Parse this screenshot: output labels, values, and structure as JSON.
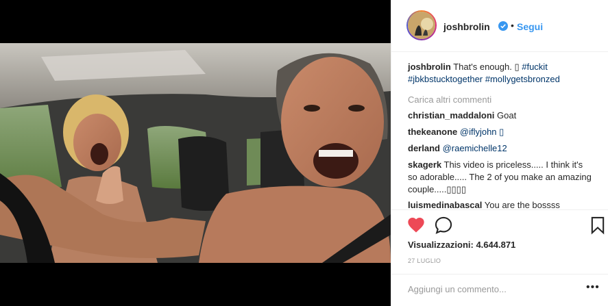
{
  "header": {
    "username": "joshbrolin",
    "dot": "•",
    "follow_label": "Segui"
  },
  "caption": {
    "username": "joshbrolin",
    "text": "That's enough. ▯",
    "tags": [
      "#fuckit",
      "#jbkbstucktogether",
      "#mollygetsbronzed"
    ]
  },
  "load_more": "Carica altri commenti",
  "comments": [
    {
      "user": "christian_maddaloni",
      "text": "Goat"
    },
    {
      "user": "thekeanone",
      "text": "@iflyjohn ▯"
    },
    {
      "user": "derland",
      "text": "@raemichelle12"
    },
    {
      "user": "skagerk",
      "text": "This video is priceless..... I think it's so adorable..... The 2 of you make an amazing couple.....▯▯▯▯"
    },
    {
      "user": "luismedinabascal",
      "text": "You are the bossss"
    }
  ],
  "views": "Visualizzazioni: 4.644.871",
  "date": "27 LUGLIO",
  "add_comment_placeholder": "Aggiungi un commento...",
  "more_label": "•••",
  "icons": [
    "heart-icon",
    "comment-icon",
    "bookmark-icon",
    "verified-icon"
  ],
  "colors": {
    "like": "#ed4956",
    "follow": "#3897f0",
    "tag": "#003569"
  }
}
